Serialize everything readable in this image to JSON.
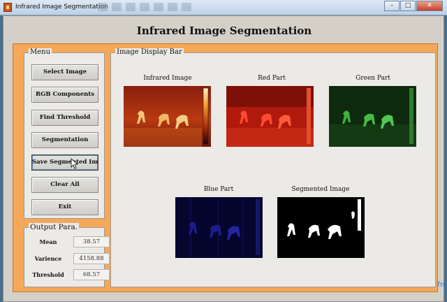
{
  "window": {
    "title": "Infrared Image Segmentation"
  },
  "page": {
    "title": "Infrared Image Segmentation"
  },
  "menu": {
    "legend": "Menu",
    "buttons": [
      {
        "label": "Select Image"
      },
      {
        "label": "RGB Components"
      },
      {
        "label": "Find Threshold"
      },
      {
        "label": "Segmentation"
      },
      {
        "label": "Save Segmented Img."
      },
      {
        "label": "Clear All"
      },
      {
        "label": "Exit"
      }
    ]
  },
  "output": {
    "legend": "Output Para.",
    "rows": [
      {
        "label": "Mean",
        "value": "38.57"
      },
      {
        "label": "Varience",
        "value": "4158.88"
      },
      {
        "label": "Threshold",
        "value": "68.57"
      }
    ]
  },
  "display": {
    "legend": "Image Display Bar",
    "images": [
      {
        "label": "Infrared Image",
        "icon": "infrared-image"
      },
      {
        "label": "Red Part",
        "icon": "red-channel-image"
      },
      {
        "label": "Green Part",
        "icon": "green-channel-image"
      },
      {
        "label": "Blue Part",
        "icon": "blue-channel-image"
      },
      {
        "label": "Segmented Image",
        "icon": "segmented-binary-image"
      }
    ]
  },
  "colors": {
    "frame": "#f5a858",
    "panel": "#eceae6"
  },
  "watermark": {
    "text": "fre"
  }
}
